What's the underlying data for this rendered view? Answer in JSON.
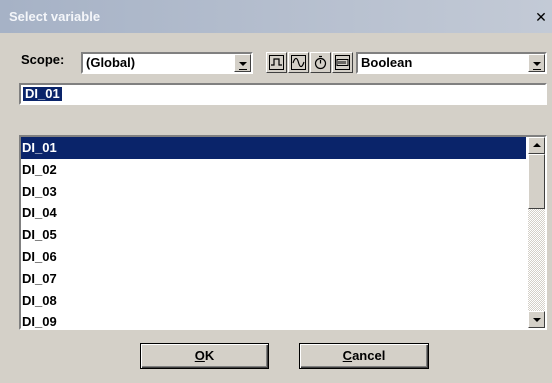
{
  "window": {
    "title": "Select variable",
    "close_glyph": "✕"
  },
  "scope": {
    "label": "Scope:",
    "value": "(Global)"
  },
  "type_filter": {
    "value": "Boolean"
  },
  "toolbar_icons": [
    "pulse-wave-icon",
    "sine-wave-icon",
    "timer-icon",
    "data-block-icon"
  ],
  "name_field": {
    "value": "DI_01"
  },
  "variables": {
    "selected_index": 0,
    "items": [
      "DI_01",
      "DI_02",
      "DI_03",
      "DI_04",
      "DI_05",
      "DI_06",
      "DI_07",
      "DI_08",
      "DI_09"
    ]
  },
  "buttons": {
    "ok": {
      "mnemonic": "O",
      "rest": "K"
    },
    "cancel": {
      "mnemonic": "C",
      "rest": "ancel"
    }
  },
  "colors": {
    "selection": "#0a246a",
    "face": "#d4d0c8"
  }
}
